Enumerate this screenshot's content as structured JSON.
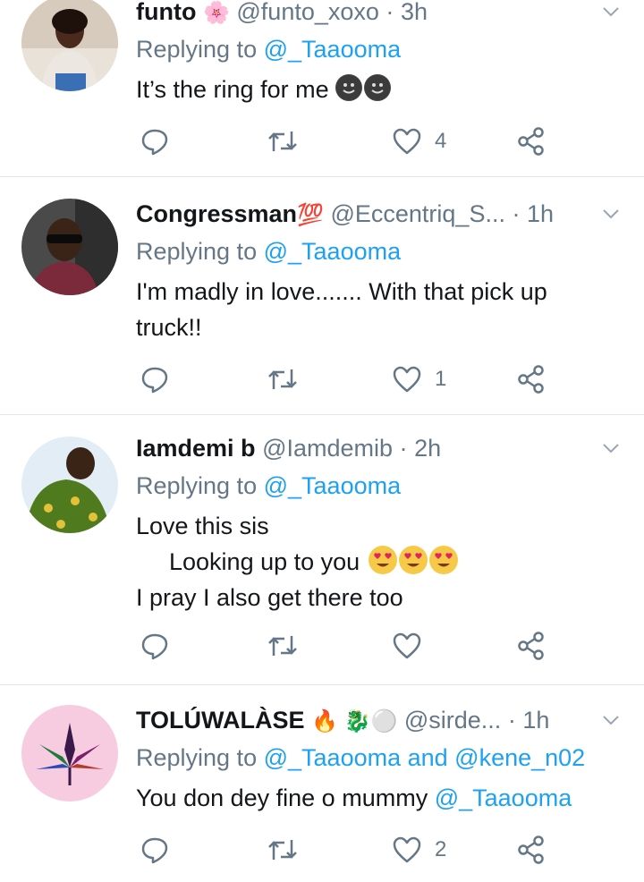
{
  "tweets": [
    {
      "name": "funto",
      "name_emoji": "🌸",
      "handle": "@funto_xoxo",
      "sep": "·",
      "time": "3h",
      "replying_prefix": "Replying to",
      "replying_to": "@_Taaooma",
      "lines": [
        "It’s the ring for me"
      ],
      "trailing_emoji_count": 2,
      "like_count": "4",
      "avatar_colors": [
        "#c8b9a6",
        "#3b2418"
      ]
    },
    {
      "name": "Congressman",
      "name_emoji": "💯",
      "handle": "@Eccentriq_S...",
      "sep": "·",
      "time": "1h",
      "replying_prefix": "Replying to",
      "replying_to": "@_Taaooma",
      "lines": [
        "I'm madly in love....... With that pick up",
        "truck!!"
      ],
      "like_count": "1",
      "avatar_colors": [
        "#3a3a3a",
        "#2b1a12"
      ]
    },
    {
      "name": "Iamdemi b",
      "handle": "@Iamdemib",
      "sep": "·",
      "time": "2h",
      "replying_prefix": "Replying to",
      "replying_to": "@_Taaooma",
      "lines": [
        "Love this sis",
        "Looking up to you",
        "I pray I also get there too"
      ],
      "heart_eyes_count": 3,
      "like_count": "",
      "avatar_colors": [
        "#dfe9f2",
        "#5a7a2a"
      ]
    },
    {
      "name": "TOLÚWALÀSE",
      "name_emoji": "🔥 🐉⚪",
      "handle": "@sirde...",
      "sep": "·",
      "time": "1h",
      "replying_prefix": "Replying to",
      "replying_to": "@_Taaooma and @kene_n02",
      "text_prefix": "You don dey fine o mummy",
      "text_mention": "@_Taaooma",
      "like_count": "2",
      "avatar_colors": [
        "#f5c6dc",
        "#4a1a5a"
      ]
    }
  ],
  "colors": {
    "link": "#1da1f2",
    "muted": "#657786",
    "text": "#14171a",
    "divider": "#e1e8ed"
  },
  "icons": [
    "reply-icon",
    "retweet-icon",
    "like-icon",
    "share-icon",
    "caret-down-icon"
  ]
}
